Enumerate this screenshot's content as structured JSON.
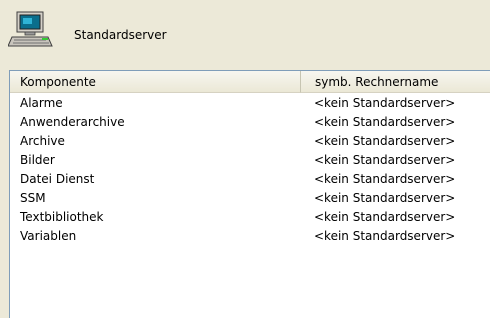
{
  "header": {
    "title": "Standardserver",
    "icon": "computer-icon"
  },
  "table": {
    "columns": [
      "Komponente",
      "symb. Rechnername"
    ],
    "rows": [
      {
        "komponente": "Alarme",
        "rechnername": "<kein Standardserver>"
      },
      {
        "komponente": "Anwenderarchive",
        "rechnername": "<kein Standardserver>"
      },
      {
        "komponente": "Archive",
        "rechnername": "<kein Standardserver>"
      },
      {
        "komponente": "Bilder",
        "rechnername": "<kein Standardserver>"
      },
      {
        "komponente": "Datei Dienst",
        "rechnername": "<kein Standardserver>"
      },
      {
        "komponente": "SSM",
        "rechnername": "<kein Standardserver>"
      },
      {
        "komponente": "Textbibliothek",
        "rechnername": "<kein Standardserver>"
      },
      {
        "komponente": "Variablen",
        "rechnername": "<kein Standardserver>"
      }
    ]
  }
}
